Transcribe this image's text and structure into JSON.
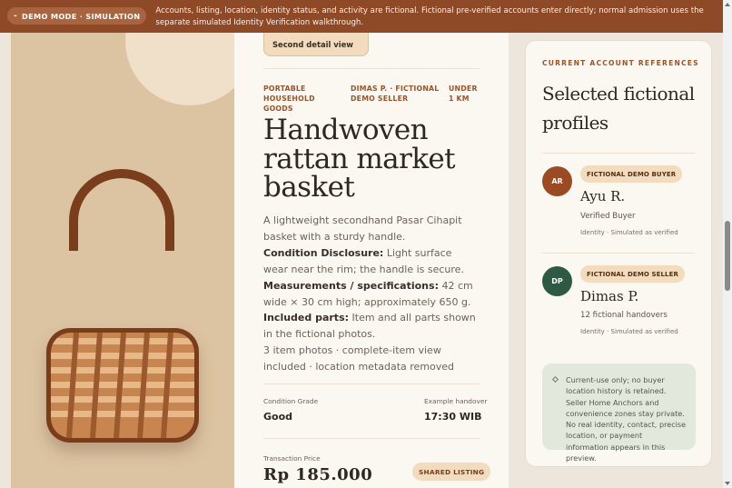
{
  "banner": {
    "badge": "DEMO MODE · SIMULATION",
    "badge_icon": "-",
    "text": "Accounts, listing, location, identity status, and activity are fictional. Fictional pre-verified accounts enter directly; normal admission uses the separate simulated Identity Verification walkthrough."
  },
  "product": {
    "detail_button": "Second detail view",
    "meta": {
      "category": "PORTABLE HOUSEHOLD GOODS",
      "seller": "DIMAS P. · FICTIONAL DEMO SELLER",
      "distance": "UNDER 1 KM"
    },
    "title": "Handwoven rattan market basket",
    "summary": "A lightweight secondhand Pasar Cihapit basket with a sturdy handle.",
    "condition_label": "Condition Disclosure:",
    "condition_text": "Light surface wear near the rim; the handle is secure.",
    "measure_label": "Measurements / specifications:",
    "measure_text": "42 cm wide × 30 cm high; approximately 650 g.",
    "included_label": "Included parts:",
    "included_text": "Item and all parts shown in the fictional photos.",
    "photos_text": "3 item photos · complete-item view included · location metadata removed",
    "condition_grade_label": "Condition Grade",
    "condition_grade": "Good",
    "handover_label": "Example handover",
    "handover_time": "17:30 WIB",
    "price_label": "Transaction Price",
    "price": "Rp 185.000",
    "shared_label": "SHARED LISTING"
  },
  "accounts": {
    "kicker": "CURRENT ACCOUNT REFERENCES",
    "title": "Selected fictional profiles",
    "buyer": {
      "initials": "AR",
      "role": "FICTIONAL DEMO BUYER",
      "name": "Ayu R.",
      "subtitle": "Verified Buyer",
      "status": "Identity · Simulated as verified",
      "color": "#9b4a22"
    },
    "seller": {
      "initials": "DP",
      "role": "FICTIONAL DEMO SELLER",
      "name": "Dimas P.",
      "subtitle": "12 fictional handovers",
      "status": "Identity · Simulated as verified",
      "color": "#2e5a44"
    },
    "notice": "Current-use only; no buyer location history is retained. Seller Home Anchors and convenience zones stay private. No real identity, contact, precise location, or payment information appears in this preview.",
    "notice_icon": "diamond-icon"
  },
  "colors": {
    "banner": "#8e4a26",
    "accent": "#9b5328",
    "image_bg": "#dcc3a2",
    "basket_frame": "#7a3e1d",
    "basket_fill": "#b8703f"
  }
}
